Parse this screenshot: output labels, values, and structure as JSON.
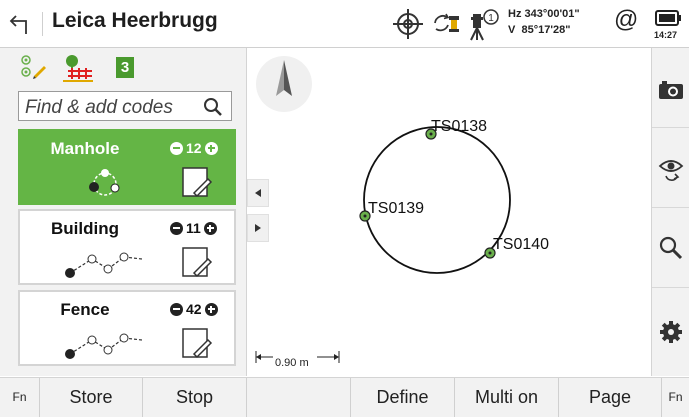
{
  "header": {
    "title": "Leica Heerbrugg",
    "hz_label": "Hz",
    "hz_value": "343°00'01\"",
    "v_label": "V",
    "v_value": "85°17'28\"",
    "at_symbol": "@",
    "battery_time": "14:27",
    "icons": [
      "back-arrow-icon",
      "target-crosshair-icon",
      "prism-lock-icon",
      "instrument-face-icon",
      "battery-icon"
    ],
    "face_number": "1"
  },
  "tabs": {
    "icons": [
      "points-mode-icon",
      "fence-line-mode-icon",
      "code-count-icon"
    ],
    "code_count": "3"
  },
  "search": {
    "placeholder": "Find & add codes"
  },
  "codes": [
    {
      "name": "Manhole",
      "count": "12",
      "selected": true,
      "icon": "circle-points-icon"
    },
    {
      "name": "Building",
      "count": "11",
      "selected": false,
      "icon": "line-points-icon"
    },
    {
      "name": "Fence",
      "count": "42",
      "selected": false,
      "icon": "line-points-icon"
    }
  ],
  "map": {
    "points": [
      "TS0138",
      "TS0139",
      "TS0140"
    ],
    "scale": "0.90 m",
    "icons": [
      "north-arrow-icon",
      "pan-left-icon",
      "pan-right-icon"
    ]
  },
  "right_toolbar": {
    "icons": [
      "camera-icon",
      "eye-refresh-icon",
      "search-icon",
      "settings-gear-icon"
    ]
  },
  "bottom_bar": {
    "fn_left": "Fn",
    "store": "Store",
    "stop": "Stop",
    "empty": "",
    "define": "Define",
    "multi_on": "Multi on",
    "page": "Page",
    "fn_right": "Fn"
  },
  "colors": {
    "selected_green": "#64b545",
    "point_green": "#6ab04c"
  }
}
